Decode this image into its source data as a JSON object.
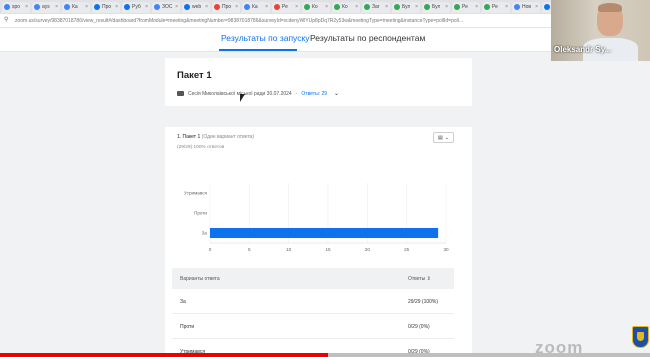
{
  "browser": {
    "tabs": [
      {
        "title": "spo",
        "color": "#4285f4"
      },
      {
        "title": "ays",
        "color": "#4285f4"
      },
      {
        "title": "Ка",
        "color": "#4285f4"
      },
      {
        "title": "Про",
        "color": "#0e72ed"
      },
      {
        "title": "Руб",
        "color": "#0e72ed"
      },
      {
        "title": "ЗОС",
        "color": "#4285f4"
      },
      {
        "title": "web",
        "color": "#0e72ed"
      },
      {
        "title": "Про",
        "color": "#ea4335"
      },
      {
        "title": "Ка",
        "color": "#4285f4"
      },
      {
        "title": "Ре",
        "color": "#ea4335"
      },
      {
        "title": "Ко",
        "color": "#34a853"
      },
      {
        "title": "Ко",
        "color": "#34a853"
      },
      {
        "title": "Заг",
        "color": "#34a853"
      },
      {
        "title": "Бул",
        "color": "#34a853"
      },
      {
        "title": "Бул",
        "color": "#34a853"
      },
      {
        "title": "Ре",
        "color": "#34a853"
      },
      {
        "title": "Ре",
        "color": "#34a853"
      },
      {
        "title": "Нов",
        "color": "#4285f4"
      },
      {
        "title": "Ре",
        "color": "#0e72ed"
      }
    ],
    "url": "zoom.us/survey/98387018786/view_result#/dashboard?fromModule=meeting&meetingNumber=98387018786&surveyId=xcdenyWlYUp8pDq7R2y53w&meetingType=meeting&instanceType=pollId=poll..."
  },
  "tabs": {
    "by_session": "Результаты по запуску",
    "by_respondent": "Результаты по респондентам"
  },
  "session": {
    "title": "Пакет 1",
    "meeting": "Сесія Миколаївської міської ради 30.07.2024",
    "answers": "Ответы: 29"
  },
  "question": {
    "title": "1. Пакет 1",
    "hint": "(Один вариант ответа)",
    "count": "(29/29) 100% ответов"
  },
  "chart_data": {
    "type": "bar",
    "orientation": "horizontal",
    "categories": [
      "Утримався",
      "Проти",
      "За"
    ],
    "values": [
      0,
      0,
      29
    ],
    "xlim": [
      0,
      30
    ],
    "xticks": [
      0,
      5,
      10,
      15,
      20,
      25,
      30
    ],
    "color": "#0e72ed",
    "grid": true
  },
  "table": {
    "headers": {
      "option": "Варианты ответа",
      "answers": "Ответы ⇕"
    },
    "rows": [
      {
        "option": "За",
        "answers": "29/29 (100%)"
      },
      {
        "option": "Проти",
        "answers": "0/29 (0%)"
      },
      {
        "option": "Утримався",
        "answers": "0/29 (0%)"
      }
    ]
  },
  "video": {
    "name": "Oleksandr Sy..."
  },
  "playback": {
    "progress": 0.505
  },
  "watermark": "zoom",
  "colors": {
    "accent": "#0e72ed",
    "progress": "#ee0000"
  }
}
